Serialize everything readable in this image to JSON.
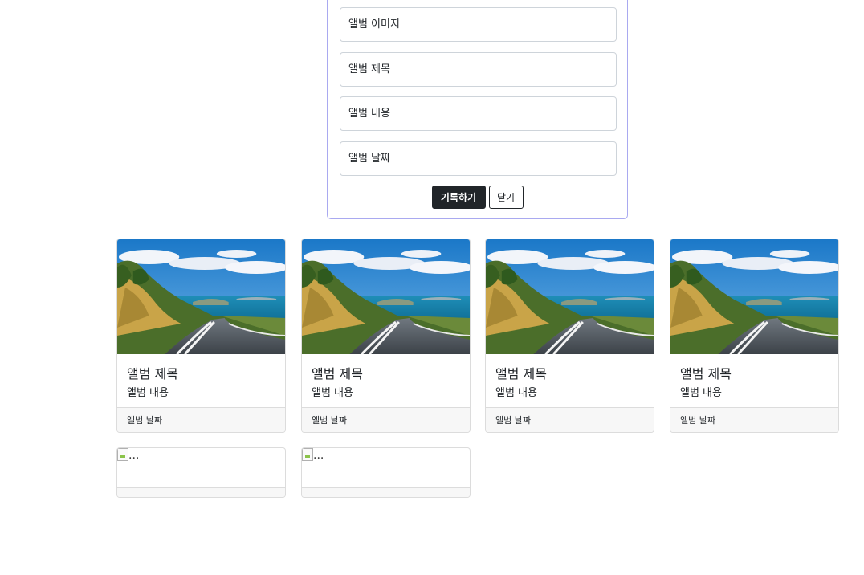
{
  "form": {
    "image_placeholder": "앨범 이미지",
    "title_placeholder": "앨범 제목",
    "content_placeholder": "앨범 내용",
    "date_placeholder": "앨범 날짜",
    "submit_label": "기록하기",
    "close_label": "닫기"
  },
  "cards": [
    {
      "title": "앨범 제목",
      "text": "앨범 내용",
      "date": "앨범 날짜"
    },
    {
      "title": "앨범 제목",
      "text": "앨범 내용",
      "date": "앨범 날짜"
    },
    {
      "title": "앨범 제목",
      "text": "앨범 내용",
      "date": "앨범 날짜"
    },
    {
      "title": "앨범 제목",
      "text": "앨범 내용",
      "date": "앨범 날짜"
    }
  ],
  "broken_cards": [
    {
      "alt": "..."
    },
    {
      "alt": "..."
    }
  ],
  "colors": {
    "panel_border": "#a9a9f0",
    "button_dark": "#212529",
    "footer_bg": "#f7f7f7"
  }
}
